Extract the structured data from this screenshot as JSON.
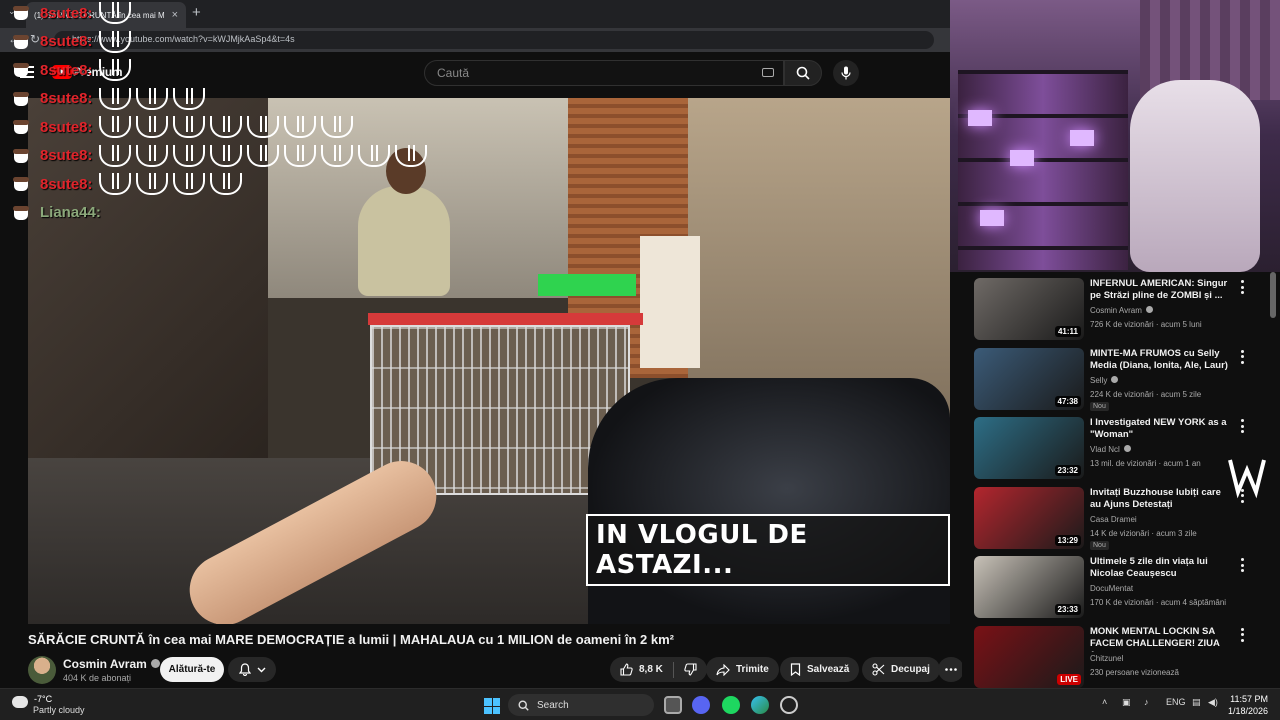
{
  "browser": {
    "tab_title": "(1) SĂRĂCIE CRUNTĂ în cea mai M",
    "new_tab": "+",
    "url": "https://www.youtube.com/watch?v=kWJMjkAaSp4&t=4s"
  },
  "header": {
    "brand": "Premium",
    "search_placeholder": "Caută"
  },
  "chat": [
    {
      "user": "8sute8:",
      "emotes": 1
    },
    {
      "user": "8sute8:",
      "emotes": 1
    },
    {
      "user": "8sute8:",
      "emotes": 1
    },
    {
      "user": "8sute8:",
      "emotes": 3
    },
    {
      "user": "8sute8:",
      "emotes": 7
    },
    {
      "user": "8sute8:",
      "emotes": 9
    },
    {
      "user": "8sute8:",
      "emotes": 4
    },
    {
      "user": "Liana44:",
      "emotes": 0
    }
  ],
  "video": {
    "caption": "IN VLOGUL DE ASTAZI..."
  },
  "watch": {
    "title": "SĂRĂCIE CRUNTĂ în cea mai MARE DEMOCRAȚIE a lumii | MAHALAUA cu 1 MILION de oameni în 2 km²",
    "channel": "Cosmin Avram",
    "subscribers": "404 K de abonați",
    "join": "Alătură-te",
    "likes": "8,8 K",
    "share": "Trimite",
    "save": "Salvează",
    "clip": "Decupaj"
  },
  "recommendations": [
    {
      "title": "INFERNUL AMERICAN: Singur pe Străzi pline de ZOMBI și ...",
      "channel": "Cosmin Avram",
      "verified": true,
      "meta": "726 K de vizionări · acum 5 luni",
      "duration": "41:11",
      "badge": "",
      "thumb": "#6f6a66"
    },
    {
      "title": "MINTE-MA FRUMOS cu Selly Media (Diana, Ionita, Ale, Laur)",
      "channel": "Selly",
      "verified": true,
      "meta": "224 K de vizionări · acum 5 zile",
      "duration": "47:38",
      "badge": "Nou",
      "thumb": "#3b5b78"
    },
    {
      "title": "I Investigated NEW YORK as a \"Woman\"",
      "channel": "Vlad Ncl",
      "verified": true,
      "meta": "13 mil. de vizionări · acum 1 an",
      "duration": "23:32",
      "badge": "",
      "thumb": "#2d6e86"
    },
    {
      "title": "Invitați Buzzhouse Iubiți care au Ajuns Detestați",
      "channel": "Casa Dramei",
      "verified": false,
      "meta": "14 K de vizionări · acum 3 zile",
      "duration": "13:29",
      "badge": "Nou",
      "thumb": "#b3262e"
    },
    {
      "title": "Ultimele 5 zile din viața lui Nicolae Ceaușescu",
      "channel": "DocuMentat",
      "verified": false,
      "meta": "170 K de vizionări · acum 4 săptămâni",
      "duration": "23:33",
      "badge": "",
      "thumb": "#c8c2b8"
    },
    {
      "title": "MONK MENTAL LOCKIN SA FACEM CHALLENGER! ZIUA 1...",
      "channel": "Chitzunel",
      "verified": false,
      "meta": "230 persoane vizionează",
      "duration": "LIVE",
      "badge": "",
      "thumb": "#7a1116"
    }
  ],
  "taskbar": {
    "temperature": "-7°C",
    "condition": "Partly cloudy",
    "search": "Search",
    "language": "ENG",
    "time": "11:57 PM",
    "date": "1/18/2026"
  },
  "colors": {
    "chat_username": "#e0242b",
    "chat_username_alt": "#8ba87a",
    "accent_red": "#ff0000",
    "windows_blue": "#4cc2ff"
  }
}
